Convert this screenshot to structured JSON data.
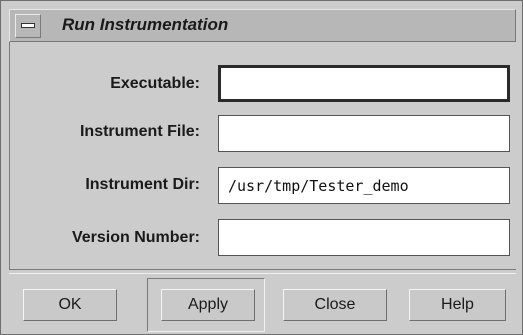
{
  "window": {
    "title": "Run Instrumentation"
  },
  "form": {
    "executable": {
      "label": "Executable:",
      "value": ""
    },
    "instrument_file": {
      "label": "Instrument File:",
      "value": ""
    },
    "instrument_dir": {
      "label": "Instrument Dir:",
      "value": "/usr/tmp/Tester_demo"
    },
    "version_number": {
      "label": "Version Number:",
      "value": ""
    }
  },
  "buttons": {
    "ok": "OK",
    "apply": "Apply",
    "close": "Close",
    "help": "Help"
  },
  "icons": {
    "window_menu": "window-menu-icon"
  }
}
